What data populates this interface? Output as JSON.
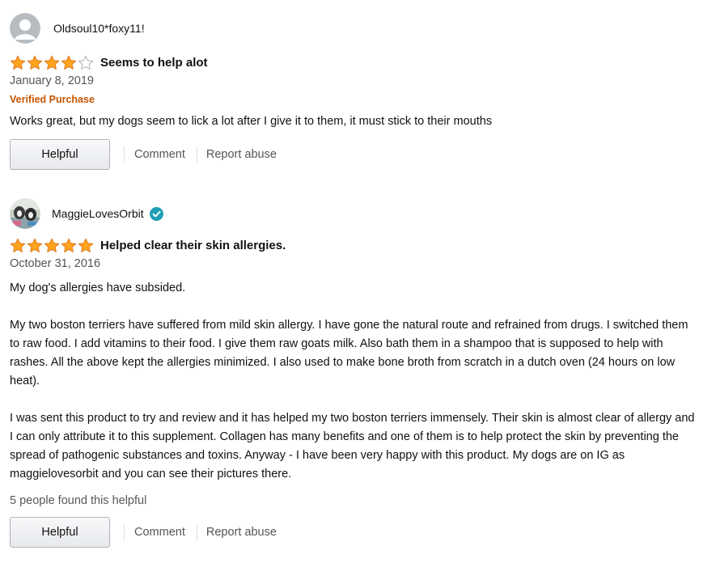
{
  "reviews": [
    {
      "profile_name": "Oldsoul10*foxy11!",
      "rating": 4,
      "max_rating": 5,
      "title": "Seems to help alot",
      "date": "January 8, 2019",
      "verified_purchase": "Verified Purchase",
      "body": [
        "Works great, but my dogs seem to lick a lot after I give it to them, it must stick to their mouths"
      ],
      "helpful_count": "",
      "actions": {
        "helpful": "Helpful",
        "comment": "Comment",
        "report": "Report abuse"
      }
    },
    {
      "profile_name": "MaggieLovesOrbit",
      "rating": 5,
      "max_rating": 5,
      "title": "Helped clear their skin allergies.",
      "date": "October 31, 2016",
      "verified_purchase": "",
      "body": [
        "My dog's allergies have subsided.",
        "My two boston terriers have suffered from mild skin allergy. I have gone the natural route and refrained from drugs. I switched them to raw food. I add vitamins to their food. I give them raw goats milk. Also bath them in a shampoo that is supposed to help with rashes. All the above kept the allergies minimized. I also used to make bone broth from scratch in a dutch oven (24 hours on low heat).",
        "I was sent this product to try and review and it has helped my two boston terriers immensely. Their skin is almost clear of allergy and I can only attribute it to this supplement. Collagen has many benefits and one of them is to help protect the skin by preventing the spread of pathogenic substances and toxins. Anyway - I have been very happy with this product. My dogs are on IG as maggielovesorbit and you can see their pictures there."
      ],
      "helpful_count": "5 people found this helpful",
      "actions": {
        "helpful": "Helpful",
        "comment": "Comment",
        "report": "Report abuse"
      }
    }
  ],
  "colors": {
    "star_fill": "#ffa41c",
    "star_stroke": "#de7921",
    "verified_purchase": "#c45500",
    "verified_badge": "#1f9fb5",
    "muted_text": "#555555"
  },
  "icons": {
    "default_avatar": "person-silhouette-icon",
    "photo_avatar": "dogs-photo-avatar",
    "verified": "check-badge-icon",
    "star": "star-icon"
  }
}
